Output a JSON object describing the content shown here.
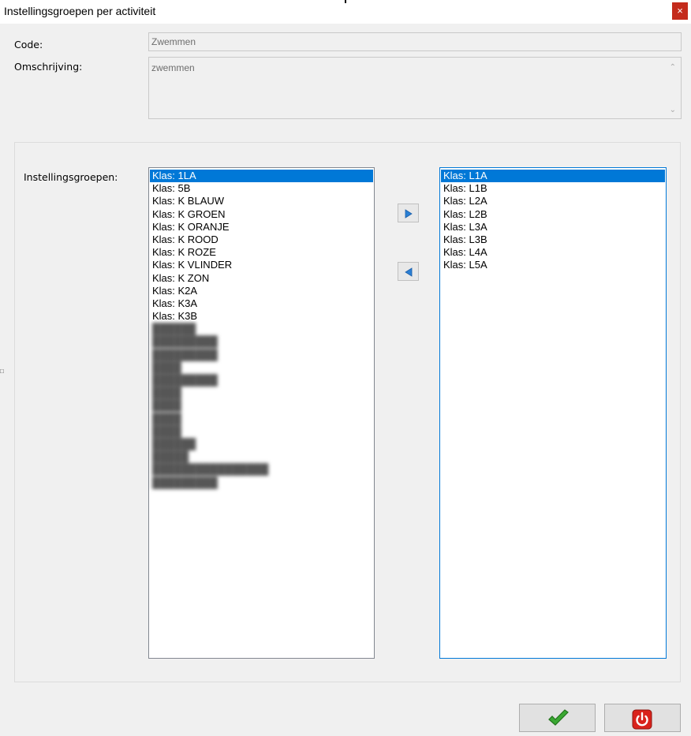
{
  "window": {
    "title": "Instellingsgroepen per activiteit",
    "close_glyph": "×"
  },
  "form": {
    "code_label": "Code:",
    "code_value": "Zwemmen",
    "omschrijving_label": "Omschrijving:",
    "omschrijving_value": "zwemmen",
    "groups_label": "Instellingsgroepen:"
  },
  "left_list": {
    "selected": "Klas: 1LA",
    "items": [
      "Klas: 1LA",
      "Klas: 5B",
      "Klas: K BLAUW",
      "Klas: K GROEN",
      "Klas: K ORANJE",
      "Klas: K ROOD",
      "Klas: K ROZE",
      "Klas: K VLINDER",
      "Klas: K ZON",
      "Klas: K2A",
      "Klas: K3A",
      "Klas: K3B"
    ]
  },
  "right_list": {
    "selected": "Klas: L1A",
    "items": [
      "Klas: L1A",
      "Klas: L1B",
      "Klas: L2A",
      "Klas: L2B",
      "Klas: L3A",
      "Klas: L3B",
      "Klas: L4A",
      "Klas: L5A"
    ]
  },
  "buttons": {
    "move_right_icon": "triangle-right-icon",
    "move_left_icon": "triangle-left-icon",
    "ok_icon": "checkmark-icon",
    "cancel_icon": "power-icon"
  },
  "colors": {
    "selection": "#0078d7",
    "close": "#c42b1c",
    "check": "#3aa832",
    "power": "#d9231c"
  }
}
